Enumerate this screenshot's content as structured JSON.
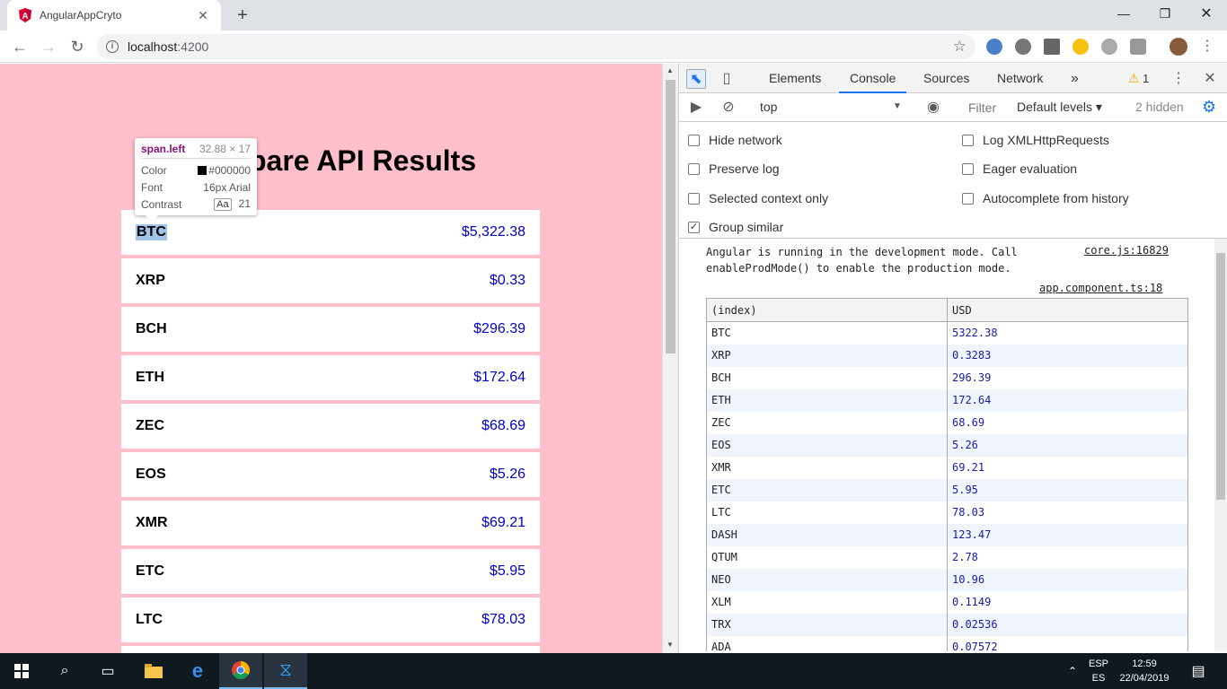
{
  "browser": {
    "tab_title": "AngularAppCryto",
    "url_host": "localhost",
    "url_port": ":4200"
  },
  "page": {
    "title": "Compare API Results",
    "coins": [
      {
        "symbol": "BTC",
        "price": "$5,322.38"
      },
      {
        "symbol": "XRP",
        "price": "$0.33"
      },
      {
        "symbol": "BCH",
        "price": "$296.39"
      },
      {
        "symbol": "ETH",
        "price": "$172.64"
      },
      {
        "symbol": "ZEC",
        "price": "$68.69"
      },
      {
        "symbol": "EOS",
        "price": "$5.26"
      },
      {
        "symbol": "XMR",
        "price": "$69.21"
      },
      {
        "symbol": "ETC",
        "price": "$5.95"
      },
      {
        "symbol": "LTC",
        "price": "$78.03"
      }
    ]
  },
  "inspector_tooltip": {
    "selector": "span.left",
    "size": "32.88 × 17",
    "color_label": "Color",
    "color_value": "#000000",
    "font_label": "Font",
    "font_value": "16px Arial",
    "contrast_label": "Contrast",
    "contrast_sample": "Aa",
    "contrast_value": "21"
  },
  "devtools": {
    "tabs": [
      "Elements",
      "Console",
      "Sources",
      "Network"
    ],
    "more": "»",
    "warnings": "1",
    "context": "top",
    "filter_placeholder": "Filter",
    "levels": "Default levels",
    "hidden": "2 hidden",
    "settings_left": [
      {
        "label": "Hide network",
        "checked": false
      },
      {
        "label": "Preserve log",
        "checked": false
      },
      {
        "label": "Selected context only",
        "checked": false
      },
      {
        "label": "Group similar",
        "checked": true
      }
    ],
    "settings_right": [
      {
        "label": "Log XMLHttpRequests",
        "checked": false
      },
      {
        "label": "Eager evaluation",
        "checked": false
      },
      {
        "label": "Autocomplete from history",
        "checked": false
      }
    ],
    "message_line1": "Angular is running in the development mode. Call",
    "message_line2": "enableProdMode() to enable the production mode.",
    "message_source": "core.js:16829",
    "table_source": "app.component.ts:18",
    "table_headers": [
      "(index)",
      "USD"
    ],
    "table_rows": [
      [
        "BTC",
        "5322.38"
      ],
      [
        "XRP",
        "0.3283"
      ],
      [
        "BCH",
        "296.39"
      ],
      [
        "ETH",
        "172.64"
      ],
      [
        "ZEC",
        "68.69"
      ],
      [
        "EOS",
        "5.26"
      ],
      [
        "XMR",
        "69.21"
      ],
      [
        "ETC",
        "5.95"
      ],
      [
        "LTC",
        "78.03"
      ],
      [
        "DASH",
        "123.47"
      ],
      [
        "QTUM",
        "2.78"
      ],
      [
        "NEO",
        "10.96"
      ],
      [
        "XLM",
        "0.1149"
      ],
      [
        "TRX",
        "0.02536"
      ],
      [
        "ADA",
        "0.07572"
      ]
    ]
  },
  "taskbar": {
    "lang_top": "ESP",
    "lang_bottom": "ES",
    "time": "12:59",
    "date": "22/04/2019"
  }
}
